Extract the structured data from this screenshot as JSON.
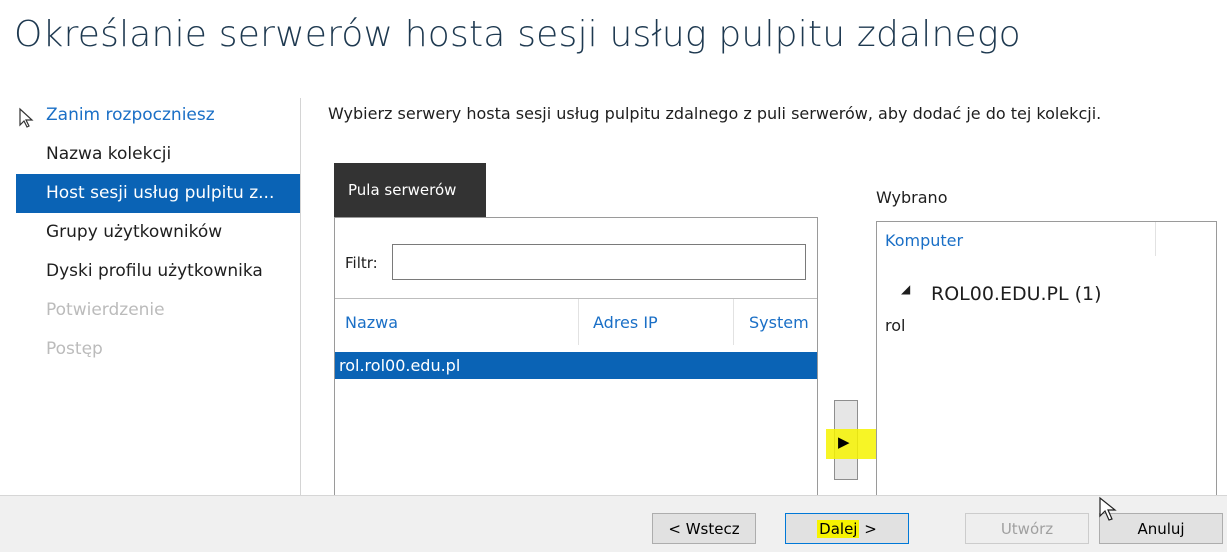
{
  "title": "Określanie serwerów hosta sesji usług pulpitu zdalnego",
  "nav": {
    "items": [
      {
        "label": "Zanim rozpoczniesz"
      },
      {
        "label": "Nazwa kolekcji"
      },
      {
        "label": "Host sesji usług pulpitu z..."
      },
      {
        "label": "Grupy użytkowników"
      },
      {
        "label": "Dyski profilu użytkownika"
      },
      {
        "label": "Potwierdzenie"
      },
      {
        "label": "Postęp"
      }
    ]
  },
  "description": "Wybierz serwery hosta sesji usług pulpitu zdalnego z puli serwerów, aby dodać je do tej kolekcji.",
  "pool": {
    "tab_label": "Pula serwerów",
    "filter_label": "Filtr:",
    "filter_value": "",
    "columns": [
      "Nazwa",
      "Adres IP",
      "System"
    ],
    "rows": [
      {
        "name": "rol.rol00.edu.pl"
      }
    ]
  },
  "selected": {
    "label": "Wybrano",
    "column": "Komputer",
    "group_label": "ROL00.EDU.PL (1)",
    "items": [
      "rol"
    ]
  },
  "buttons": {
    "add": "▶",
    "back": "< Wstecz",
    "next_prefix": "Dalej",
    "next_suffix": " >",
    "create": "Utwórz",
    "cancel": "Anuluj"
  },
  "colors": {
    "accent": "#0a63b5",
    "highlight": "#f6f300",
    "link": "#1a6fc6"
  }
}
